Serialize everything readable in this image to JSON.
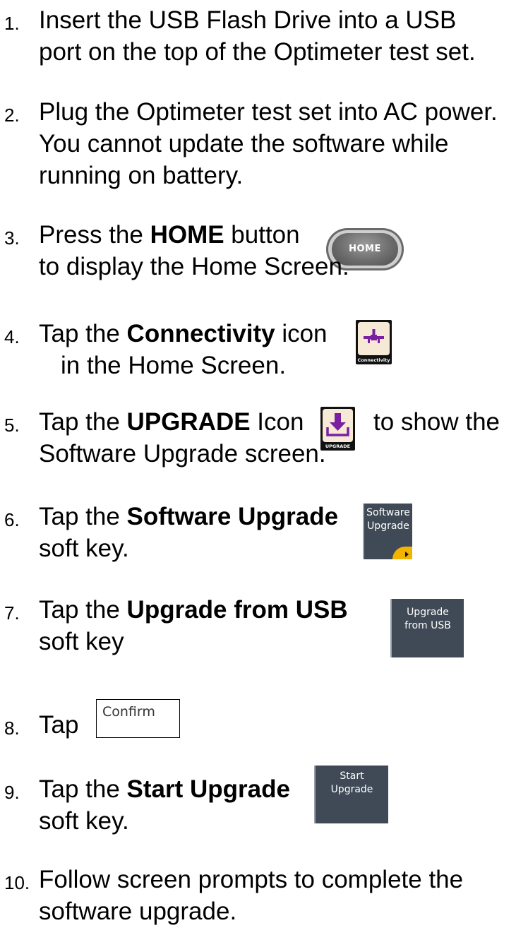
{
  "steps": [
    {
      "num": "1.",
      "lines": [
        "Insert the USB Flash Drive into a USB",
        "port on the top of the Optimeter test set."
      ]
    },
    {
      "num": "2.",
      "lines": [
        "Plug the Optimeter test set into AC power.",
        "You cannot update the software while",
        "running on battery."
      ]
    },
    {
      "num": "3.",
      "pre": "Press the ",
      "bold": "HOME",
      "post": " button",
      "line2": "to display the Home Screen."
    },
    {
      "num": "4.",
      "pre": "Tap the ",
      "bold": "Connectivity",
      "post": " icon",
      "line2": "in the Home Screen."
    },
    {
      "num": "5.",
      "pre": "Tap the ",
      "bold": "UPGRADE",
      "post": " Icon",
      "post2": "to show the",
      "line2": "Software Upgrade screen."
    },
    {
      "num": "6.",
      "pre": "Tap the ",
      "bold": "Software Upgrade",
      "line2": "soft key."
    },
    {
      "num": "7.",
      "pre": "Tap the ",
      "bold": "Upgrade from USB",
      "line2": "soft key"
    },
    {
      "num": "8.",
      "pre": "Tap"
    },
    {
      "num": "9.",
      "pre": "Tap the ",
      "bold": "Start Upgrade",
      "line2": "soft key."
    },
    {
      "num": "10.",
      "lines": [
        "Follow screen prompts to complete the",
        "software upgrade."
      ]
    }
  ],
  "icons": {
    "home_button": "HOME",
    "connectivity": "Connectivity",
    "upgrade": "UPGRADE",
    "softkey_software_upgrade": [
      "Software",
      "Upgrade"
    ],
    "softkey_upgrade_from_usb": [
      "Upgrade",
      "from USB"
    ],
    "confirm_button": "Confirm",
    "softkey_start_upgrade": [
      "Start",
      "Upgrade"
    ]
  },
  "colors": {
    "softkey_bg": "#3f4a56",
    "accent_orange": "#f2b400",
    "icon_purple": "#7b1fa2",
    "icon_tile_bg": "#f6ead6"
  }
}
